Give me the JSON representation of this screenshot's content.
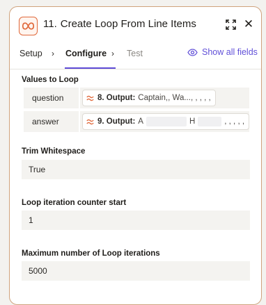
{
  "header": {
    "step_number": "11.",
    "title": "Create Loop From Line Items",
    "close_glyph": "✕",
    "icon": "loop-icon",
    "accent_color": "#e0683a"
  },
  "tabs": [
    {
      "label": "Setup",
      "state": "done"
    },
    {
      "label": "Configure",
      "state": "active"
    },
    {
      "label": "Test",
      "state": "inactive"
    }
  ],
  "tab_separator": "›",
  "show_all_fields": {
    "label": "Show all fields",
    "icon": "eye-icon",
    "color": "#6150d8"
  },
  "values_to_loop": {
    "label": "Values to Loop",
    "rows": [
      {
        "key": "question",
        "step": "8. Output:",
        "value_prefix": "Captain,",
        "value_suffix": ", Wa..., , , , ,"
      },
      {
        "key": "answer",
        "step": "9. Output:",
        "value_prefix": "A",
        "value_suffix": "H",
        "value_tail": ", , , , ,"
      }
    ]
  },
  "fields": [
    {
      "label": "Trim Whitespace",
      "value": "True"
    },
    {
      "label": "Loop iteration counter start",
      "value": "1"
    },
    {
      "label": "Maximum number of Loop iterations",
      "value": "5000"
    }
  ]
}
